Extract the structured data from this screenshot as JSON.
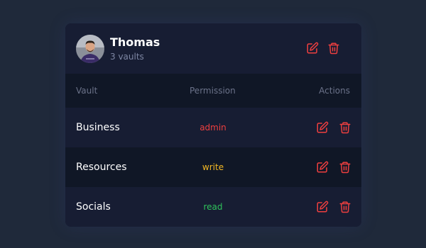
{
  "user": {
    "name": "Thomas",
    "subtitle": "3 vaults"
  },
  "table": {
    "headers": {
      "vault": "Vault",
      "permission": "Permission",
      "actions": "Actions"
    },
    "rows": [
      {
        "name": "Business",
        "permission": "admin",
        "permission_color": "#ef3f3f"
      },
      {
        "name": "Resources",
        "permission": "write",
        "permission_color": "#f4b824"
      },
      {
        "name": "Socials",
        "permission": "read",
        "permission_color": "#2fc25b"
      }
    ]
  },
  "colors": {
    "background": "#1f293a",
    "card": "#141b2d",
    "accent_red": "#ef3f3f",
    "muted_text": "#7d86a3"
  },
  "icons": {
    "edit": "edit-icon",
    "delete": "trash-icon"
  }
}
